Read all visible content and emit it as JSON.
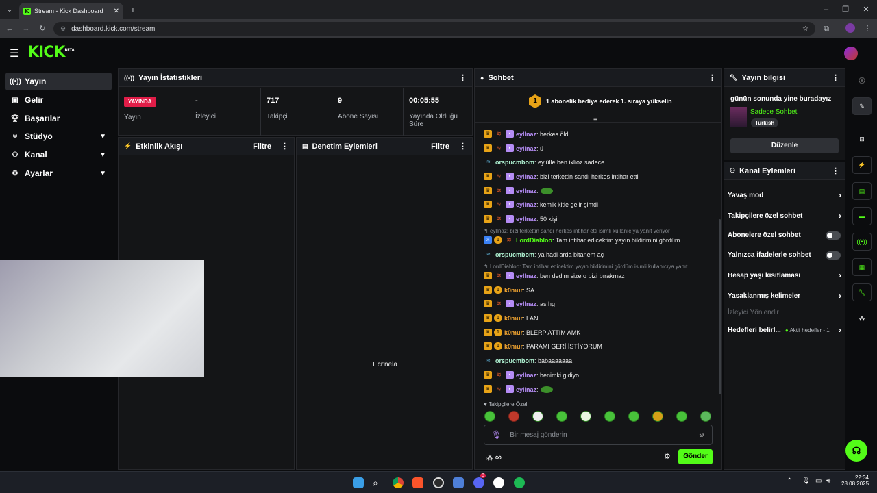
{
  "browser": {
    "tab_title": "Stream - Kick Dashboard",
    "url": "dashboard.kick.com/stream"
  },
  "app": {
    "logo": "KICK",
    "logo_badge": "BETA"
  },
  "sidebar": {
    "items": [
      {
        "label": "Yayın",
        "icon": "broadcast-icon"
      },
      {
        "label": "Gelir",
        "icon": "wallet-icon"
      },
      {
        "label": "Başarılar",
        "icon": "trophy-icon"
      },
      {
        "label": "Stüdyo",
        "icon": "studio-icon"
      },
      {
        "label": "Kanal",
        "icon": "users-icon"
      },
      {
        "label": "Ayarlar",
        "icon": "gear-icon"
      }
    ]
  },
  "stats": {
    "title": "Yayın İstatistikleri",
    "status_badge": "YAYINDA",
    "status_label": "Yayın",
    "viewers_value": "-",
    "viewers_label": "İzleyici",
    "followers_value": "717",
    "followers_label": "Takipçi",
    "subs_value": "9",
    "subs_label": "Abone Sayısı",
    "uptime_value": "00:05:55",
    "uptime_label": "Yayında Olduğu Süre"
  },
  "activity": {
    "title": "Etkinlik Akışı",
    "filter": "Filtre"
  },
  "moderation": {
    "title": "Denetim Eylemleri",
    "filter": "Filtre",
    "empty": "Ecr'nela"
  },
  "chat": {
    "title": "Sohbet",
    "pinned_rank": "1",
    "pinned": "1 abonelik hediye ederek 1. sıraya yükselin",
    "messages": [
      {
        "user": "eyllnaz",
        "text": ": herkes öld"
      },
      {
        "user": "eyllnaz",
        "text": ": ü"
      },
      {
        "user": "orspucmbom",
        "text": ": eylülle ben ixlioz sadece"
      },
      {
        "user": "eyllnaz",
        "text": ": bizi terkettin sandı herkes intihar etti"
      },
      {
        "user": "eyllnaz",
        "text": ":"
      },
      {
        "user": "eyllnaz",
        "text": ": kemik kitle gelir şimdi"
      },
      {
        "user": "eyllnaz",
        "text": ": 50 kişi"
      },
      {
        "reply": "eyllnaz: bizi terkettin sandı herkes intihar etti isimli kullanıcıya yanıt veriyor"
      },
      {
        "user": "LordDiabloo",
        "text": ": Tam intihar edicektim yayın bildirimini gördüm"
      },
      {
        "user": "orspucmbom",
        "text": ": ya hadi arda bitanem aç"
      },
      {
        "reply": "LordDiabloo: Tam intihar edicektim yayın bildirimini gördüm isimli kullanıcıya yanıt ..."
      },
      {
        "user": "eyllnaz",
        "text": ": ben dedim size o bizi bırakmaz"
      },
      {
        "user": "k0mur",
        "text": ": SA"
      },
      {
        "user": "eyllnaz",
        "text": ": as hg"
      },
      {
        "user": "k0mur",
        "text": ": LAN"
      },
      {
        "user": "k0mur",
        "text": ": BLERP ATTIM AMK"
      },
      {
        "user": "k0mur",
        "text": ": PARAMI GERİ İSTİYORUM"
      },
      {
        "user": "orspucmbom",
        "text": ": babaaaaaaa"
      },
      {
        "user": "eyllnaz",
        "text": ": benimki gidiyo"
      },
      {
        "user": "eyllnaz",
        "text": ":"
      }
    ],
    "followers_only": "Takipçilere Özel",
    "input_placeholder": "Bir mesaj gönderin",
    "send": "Gönder",
    "infinity": "∞"
  },
  "info": {
    "title": "Yayın bilgisi",
    "stream_title": "günün sonunda yine buradayız",
    "category": "Sadece Sohbet",
    "language": "Turkish",
    "edit": "Düzenle"
  },
  "actions": {
    "title": "Kanal Eylemleri",
    "slow": "Yavaş mod",
    "followers": "Takipçilere özel sohbet",
    "subs": "Abonelere özel sohbet",
    "emotes": "Yalnızca ifadelerle sohbet",
    "age": "Hesap yaşı kısıtlaması",
    "banned": "Yasaklanmış kelimeler",
    "redirect": "İzleyici Yönlendir",
    "goals": "Hedefleri belirl...",
    "goals_status": "Aktif hedefler - 1"
  },
  "taskbar": {
    "time": "22:34",
    "date": "28.08.2025",
    "discord_badge": "8"
  },
  "colors": {
    "accent": "#53fc18",
    "live": "#e11d48"
  }
}
